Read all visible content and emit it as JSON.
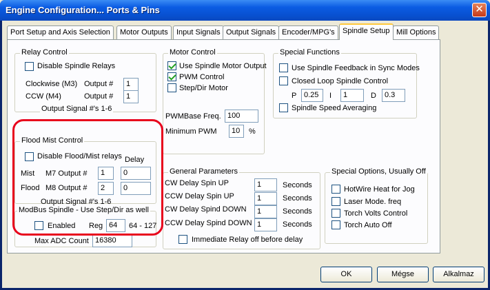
{
  "window": {
    "title": "Engine Configuration... Ports & Pins",
    "close_glyph": "✕"
  },
  "tabs": [
    {
      "label": "Port Setup and Axis Selection"
    },
    {
      "label": "Motor Outputs"
    },
    {
      "label": "Input Signals"
    },
    {
      "label": "Output Signals"
    },
    {
      "label": "Encoder/MPG's"
    },
    {
      "label": "Spindle Setup"
    },
    {
      "label": "Mill Options"
    }
  ],
  "active_tab": "Spindle Setup",
  "relay_control": {
    "title": "Relay Control",
    "disable_label": "Disable Spindle Relays",
    "cw_label": "Clockwise (M3)",
    "ccw_label": "CCW (M4)",
    "output_label": "Output #",
    "cw_value": "1",
    "ccw_value": "1",
    "footer": "Output Signal #'s 1-6"
  },
  "flood_mist": {
    "title": "Flood Mist Control",
    "disable_label": "Disable Flood/Mist relays",
    "delay_label": "Delay",
    "mist_label": "Mist",
    "m7_label": "M7 Output #",
    "m7_value": "1",
    "mist_delay": "0",
    "flood_label": "Flood",
    "m8_label": "M8 Output #",
    "m8_value": "2",
    "flood_delay": "0",
    "footer": "Output Signal #'s 1-6"
  },
  "modbus": {
    "title": "ModBus Spindle - Use Step/Dir as well",
    "enabled_label": "Enabled",
    "reg_label": "Reg",
    "reg_value": "64",
    "range": "64 - 127",
    "max_adc_label": "Max ADC Count",
    "max_adc_value": "16380"
  },
  "motor_control": {
    "title": "Motor Control",
    "use_spindle_motor": "Use Spindle Motor Output",
    "pwm_control": "PWM Control",
    "step_dir": "Step/Dir Motor",
    "pwm_base_label": "PWMBase Freq.",
    "pwm_base_value": "100",
    "min_pwm_label": "Minimum PWM",
    "min_pwm_value": "10",
    "percent": "%"
  },
  "special_functions": {
    "title": "Special Functions",
    "feedback": "Use Spindle Feedback in Sync Modes",
    "closed_loop": "Closed Loop Spindle Control",
    "p_label": "P",
    "p_value": "0.25",
    "i_label": "I",
    "i_value": "1",
    "d_label": "D",
    "d_value": "0.3",
    "averaging": "Spindle Speed Averaging"
  },
  "general": {
    "title": "General Parameters",
    "rows": [
      {
        "label": "CW Delay Spin UP",
        "value": "1",
        "unit": "Seconds"
      },
      {
        "label": "CCW Delay Spin UP",
        "value": "1",
        "unit": "Seconds"
      },
      {
        "label": "CW Delay Spind DOWN",
        "value": "1",
        "unit": "Seconds"
      },
      {
        "label": "CCW Delay Spind DOWN",
        "value": "1",
        "unit": "Seconds"
      }
    ],
    "immediate_relay": "Immediate Relay off before delay"
  },
  "special_options": {
    "title": "Special Options, Usually Off",
    "hotwire": "HotWire Heat for Jog",
    "laser": "Laser Mode. freq",
    "torch_volts": "Torch Volts Control",
    "torch_auto": "Torch Auto Off"
  },
  "buttons": {
    "ok": "OK",
    "cancel": "Mégse",
    "apply": "Alkalmaz"
  },
  "colors": {
    "highlight_box": "#e8001c",
    "titlebar": "#0b5ce3"
  }
}
